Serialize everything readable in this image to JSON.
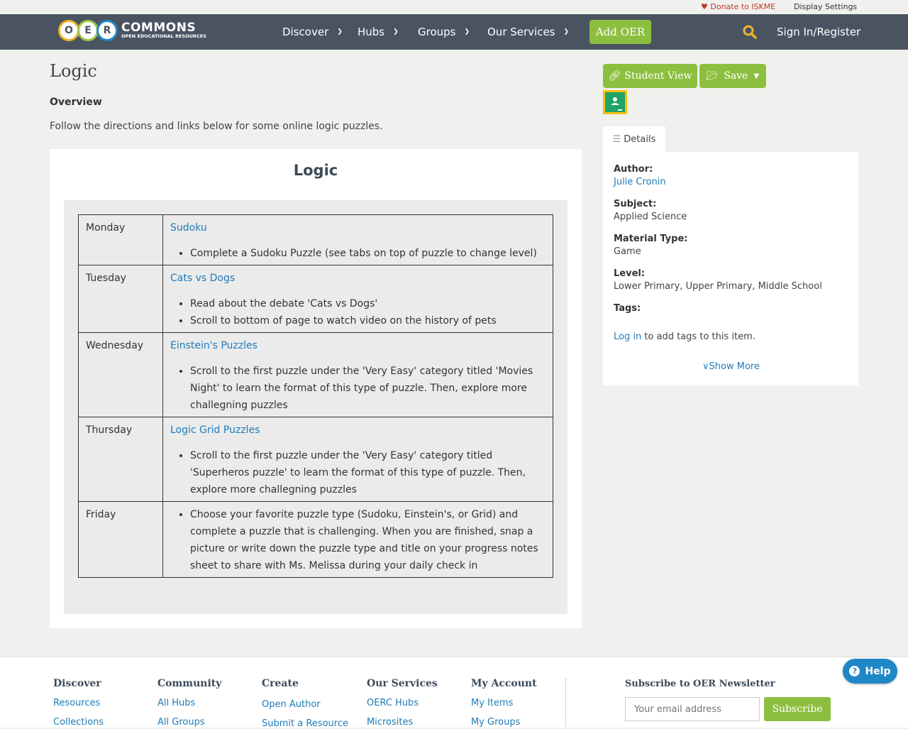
{
  "topbar": {
    "donate_label": "Donate to ISKME",
    "display_settings_label": "Display Settings"
  },
  "header": {
    "logo": {
      "letters": [
        "O",
        "E",
        "R"
      ],
      "word": "COMMONS",
      "tagline": "OPEN EDUCATIONAL RESOURCES"
    },
    "nav": [
      {
        "label": "Discover"
      },
      {
        "label": "Hubs"
      },
      {
        "label": "Groups"
      },
      {
        "label": "Our Services"
      }
    ],
    "add_oer_label": "Add OER",
    "sign_in_label": "Sign In/Register"
  },
  "main": {
    "title": "Logic",
    "overview_heading": "Overview",
    "overview_text": "Follow the directions and links below for some online logic puzzles.",
    "card_title": "Logic",
    "schedule": [
      {
        "day": "Monday",
        "link": "Sudoku",
        "items": [
          "Complete a Sudoku Puzzle (see tabs on top of puzzle to change level)"
        ]
      },
      {
        "day": "Tuesday",
        "link": "Cats vs Dogs",
        "items": [
          "Read about the debate 'Cats vs Dogs'",
          "Scroll to bottom of page to watch video on the history of pets"
        ]
      },
      {
        "day": "Wednesday",
        "link": "Einstein's Puzzles",
        "items": [
          "Scroll to the first puzzle under the 'Very Easy' category titled 'Movies Night' to learn the format of this type of puzzle. Then, explore more challegning puzzles"
        ]
      },
      {
        "day": "Thursday",
        "link": "Logic Grid Puzzles",
        "items": [
          "Scroll to the first puzzle under the 'Very Easy' category titled 'Superheros puzzle' to learn the format of this type of puzzle. Then, explore more challegning puzzles"
        ]
      },
      {
        "day": "Friday",
        "link": "",
        "items": [
          "Choose your favorite puzzle type (Sudoku, Einstein's, or Grid) and complete a puzzle that is challenging. When you are finished, snap a picture or write down the puzzle type and title on your progress notes sheet to share with Ms. Melissa during your daily check in"
        ]
      }
    ]
  },
  "sidebar": {
    "student_view_label": "Student View",
    "save_label": "Save",
    "details_tab_label": "Details",
    "author_label": "Author:",
    "author_value": "Julie Cronin",
    "subject_label": "Subject:",
    "subject_value": "Applied Science",
    "material_type_label": "Material Type:",
    "material_type_value": "Game",
    "level_label": "Level:",
    "level_value": "Lower Primary, Upper Primary, Middle School",
    "tags_label": "Tags:",
    "login_link": "Log in",
    "login_suffix": " to add tags to this item.",
    "show_more_label": "Show More"
  },
  "footer": {
    "columns": [
      {
        "heading": "Discover",
        "links": [
          "Resources",
          "Collections"
        ]
      },
      {
        "heading": "Community",
        "links": [
          "All Hubs",
          "All Groups"
        ]
      },
      {
        "heading": "Create",
        "links": [
          "Open Author",
          "Submit a Resource"
        ]
      },
      {
        "heading": "Our Services",
        "links": [
          "OERC Hubs",
          "Microsites"
        ]
      },
      {
        "heading": "My Account",
        "links": [
          "My Items",
          "My Groups"
        ]
      }
    ],
    "newsletter_heading": "Subscribe to OER Newsletter",
    "email_placeholder": "Your email address",
    "subscribe_label": "Subscribe"
  },
  "help_label": "Help",
  "colors": {
    "nav_bg": "#4a5461",
    "accent_green": "#8cbf3f",
    "link_blue": "#1e7bb8",
    "donate_red": "#c0392b"
  }
}
